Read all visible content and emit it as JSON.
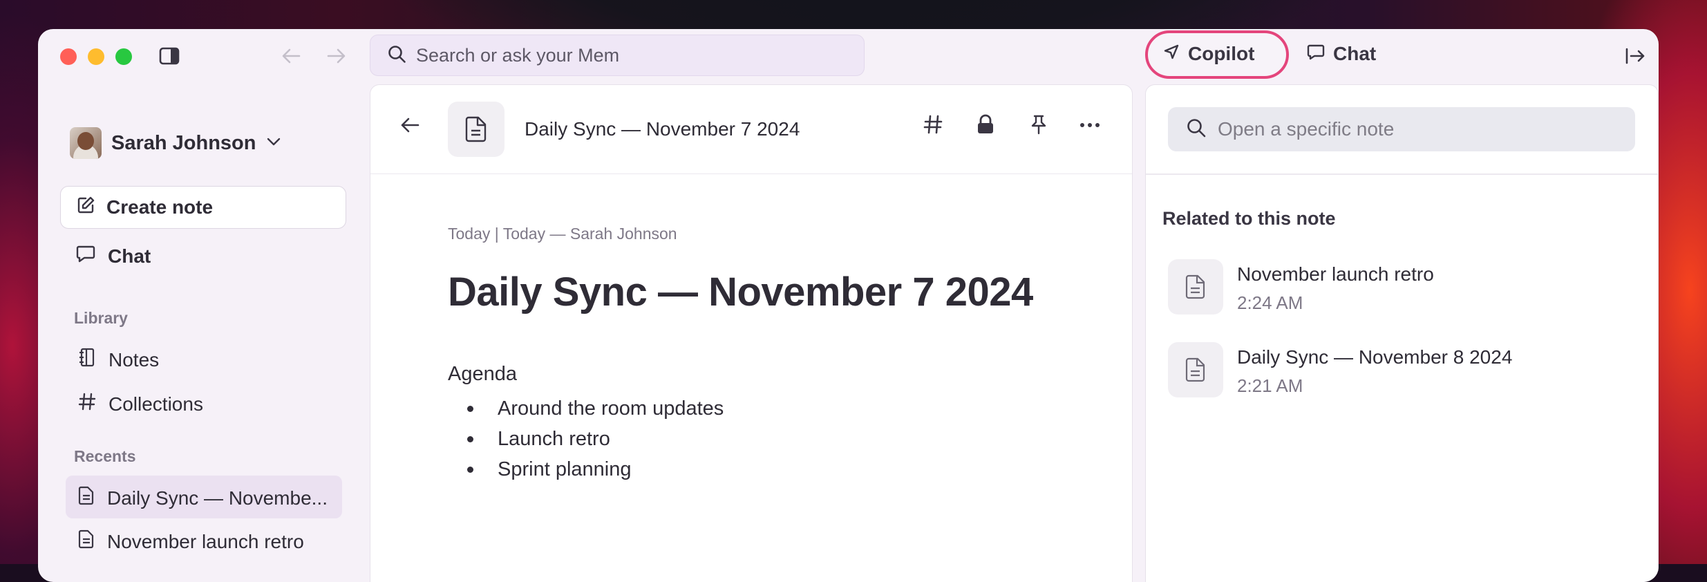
{
  "colors": {
    "accent_ring": "#e4457c",
    "window_bg": "#f6f1f8",
    "selected_bg": "#ebe1f1"
  },
  "toolbar": {
    "search_placeholder": "Search or ask your Mem",
    "copilot_label": "Copilot",
    "chat_label": "Chat",
    "icons": [
      "sidebar-toggle-icon",
      "back-arrow-icon",
      "forward-arrow-icon",
      "search-icon",
      "navigation-arrow-icon",
      "chat-bubble-icon",
      "collapse-panel-icon"
    ]
  },
  "sidebar": {
    "user_name": "Sarah Johnson",
    "create_note_label": "Create note",
    "chat_label": "Chat",
    "library_label": "Library",
    "library_items": [
      {
        "label": "Notes",
        "icon": "notebook-icon"
      },
      {
        "label": "Collections",
        "icon": "hash-icon"
      }
    ],
    "recents_label": "Recents",
    "recents": [
      {
        "label": "Daily Sync — Novembe...",
        "icon": "document-icon",
        "selected": true
      },
      {
        "label": "November launch retro",
        "icon": "document-icon",
        "selected": false
      }
    ]
  },
  "note": {
    "header_title": "Daily Sync — November 7 2024",
    "meta": "Today | Today — Sarah Johnson",
    "title": "Daily Sync — November 7 2024",
    "agenda_label": "Agenda",
    "bullets": [
      "Around the room updates",
      "Launch retro",
      "Sprint planning"
    ],
    "header_icons": [
      "hash-icon",
      "lock-icon",
      "pin-icon",
      "more-icon"
    ]
  },
  "copilot": {
    "search_placeholder": "Open a specific note",
    "related_label": "Related to this note",
    "related": [
      {
        "title": "November launch retro",
        "time": "2:24 AM"
      },
      {
        "title": "Daily Sync — November 8 2024",
        "time": "2:21 AM"
      }
    ]
  }
}
